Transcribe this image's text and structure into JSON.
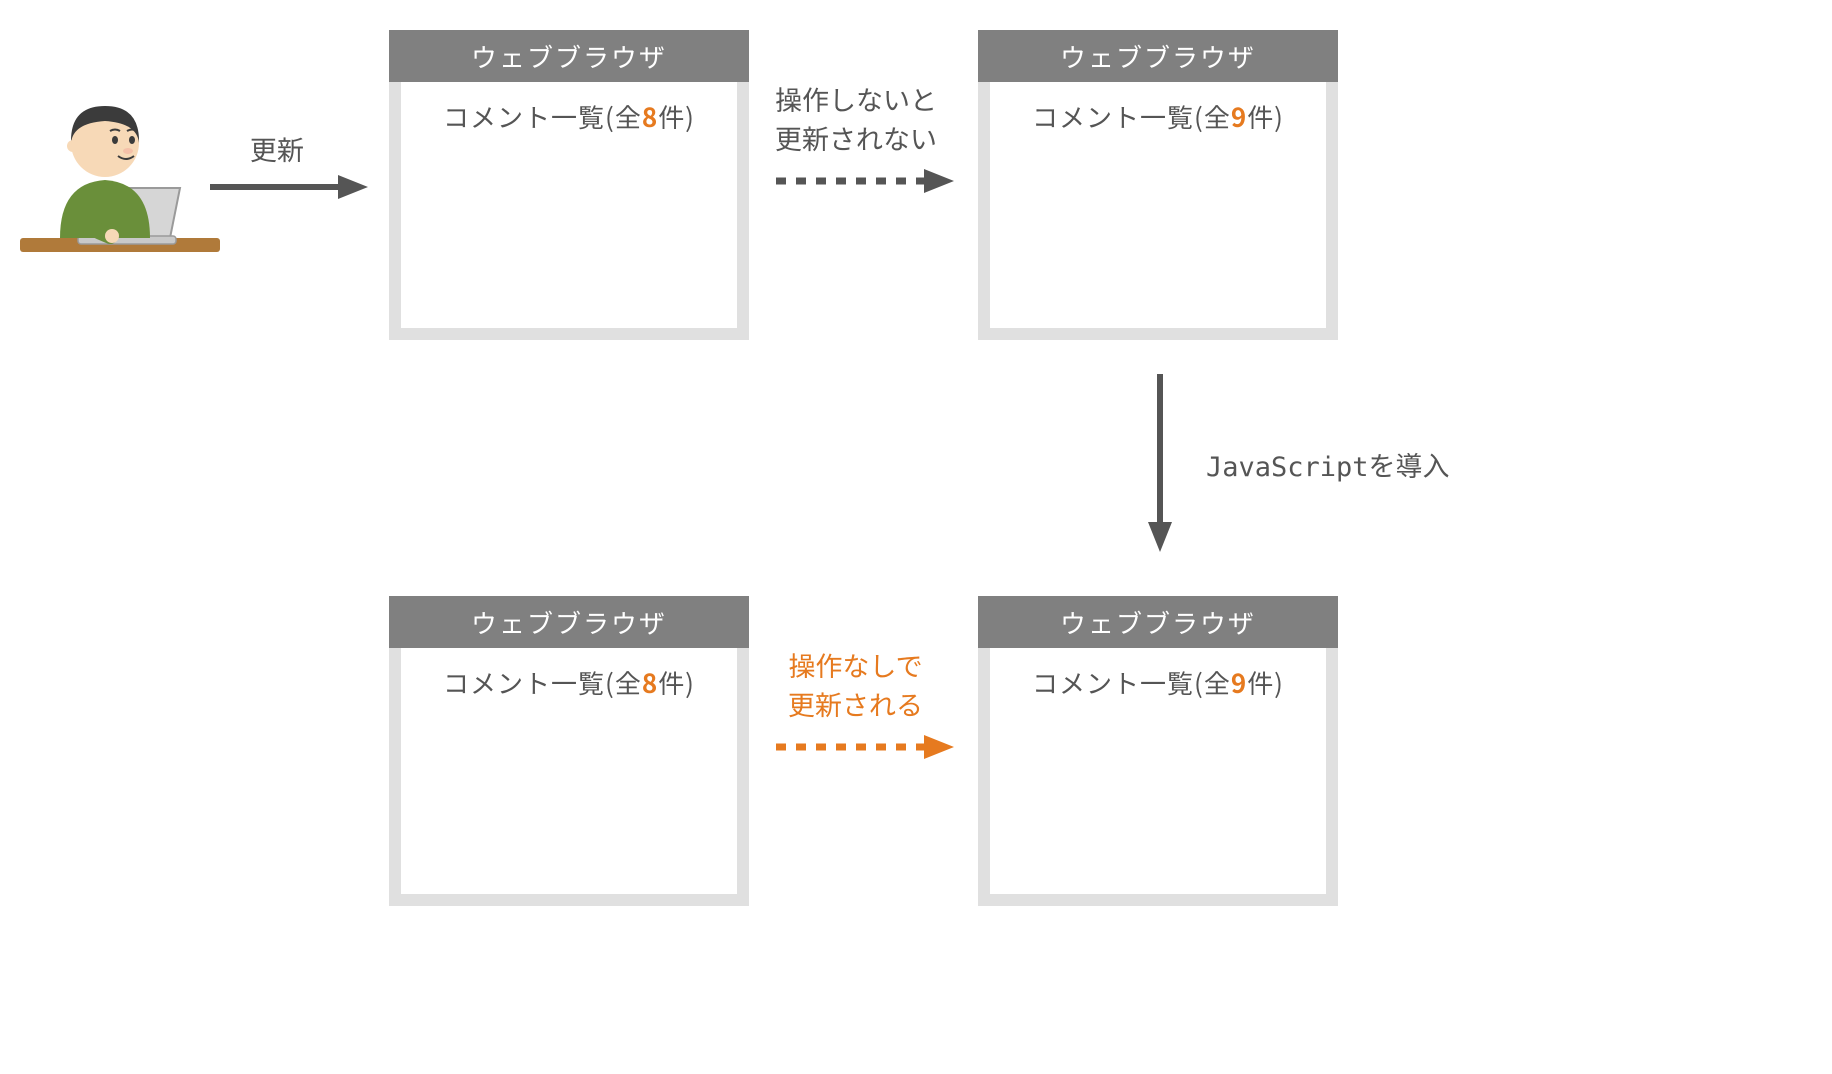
{
  "label_update": "更新",
  "label_no_update": {
    "line1": "操作しないと",
    "line2": "更新されない"
  },
  "label_auto_update": {
    "line1": "操作なしで",
    "line2": "更新される"
  },
  "label_js": "JavaScriptを導入",
  "browser_title": "ウェブブラウザ",
  "comment_prefix": "コメント一覧(全",
  "comment_suffix": "件)",
  "counts": {
    "before": "8",
    "after": "9"
  },
  "colors": {
    "gray": "#555555",
    "orange": "#e67a1f",
    "header_gray": "#808080"
  }
}
